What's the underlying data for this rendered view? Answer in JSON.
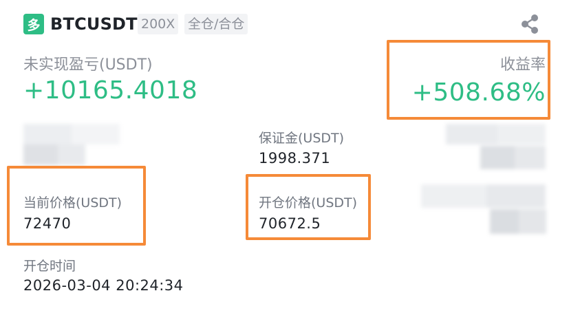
{
  "colors": {
    "long_green": "#2ebd85",
    "value_green": "#2ebd85",
    "highlight_orange": "#f58a38"
  },
  "header": {
    "direction_badge": "多",
    "symbol": "BTCUSDT",
    "leverage": "200X",
    "margin_mode": "全仓/合仓",
    "share_icon": "share-icon"
  },
  "pnl": {
    "label": "未实现盈亏(USDT)",
    "value": "+10165.4018"
  },
  "roi": {
    "label": "收益率",
    "value": "+508.68%"
  },
  "margin": {
    "label": "保证金(USDT)",
    "value": "1998.371"
  },
  "mark_price": {
    "label": "当前价格(USDT)",
    "value": "72470"
  },
  "entry_price": {
    "label": "开仓价格(USDT)",
    "value": "70672.5"
  },
  "open_time": {
    "label": "开仓时间",
    "value": "2026-03-04 20:24:34"
  }
}
